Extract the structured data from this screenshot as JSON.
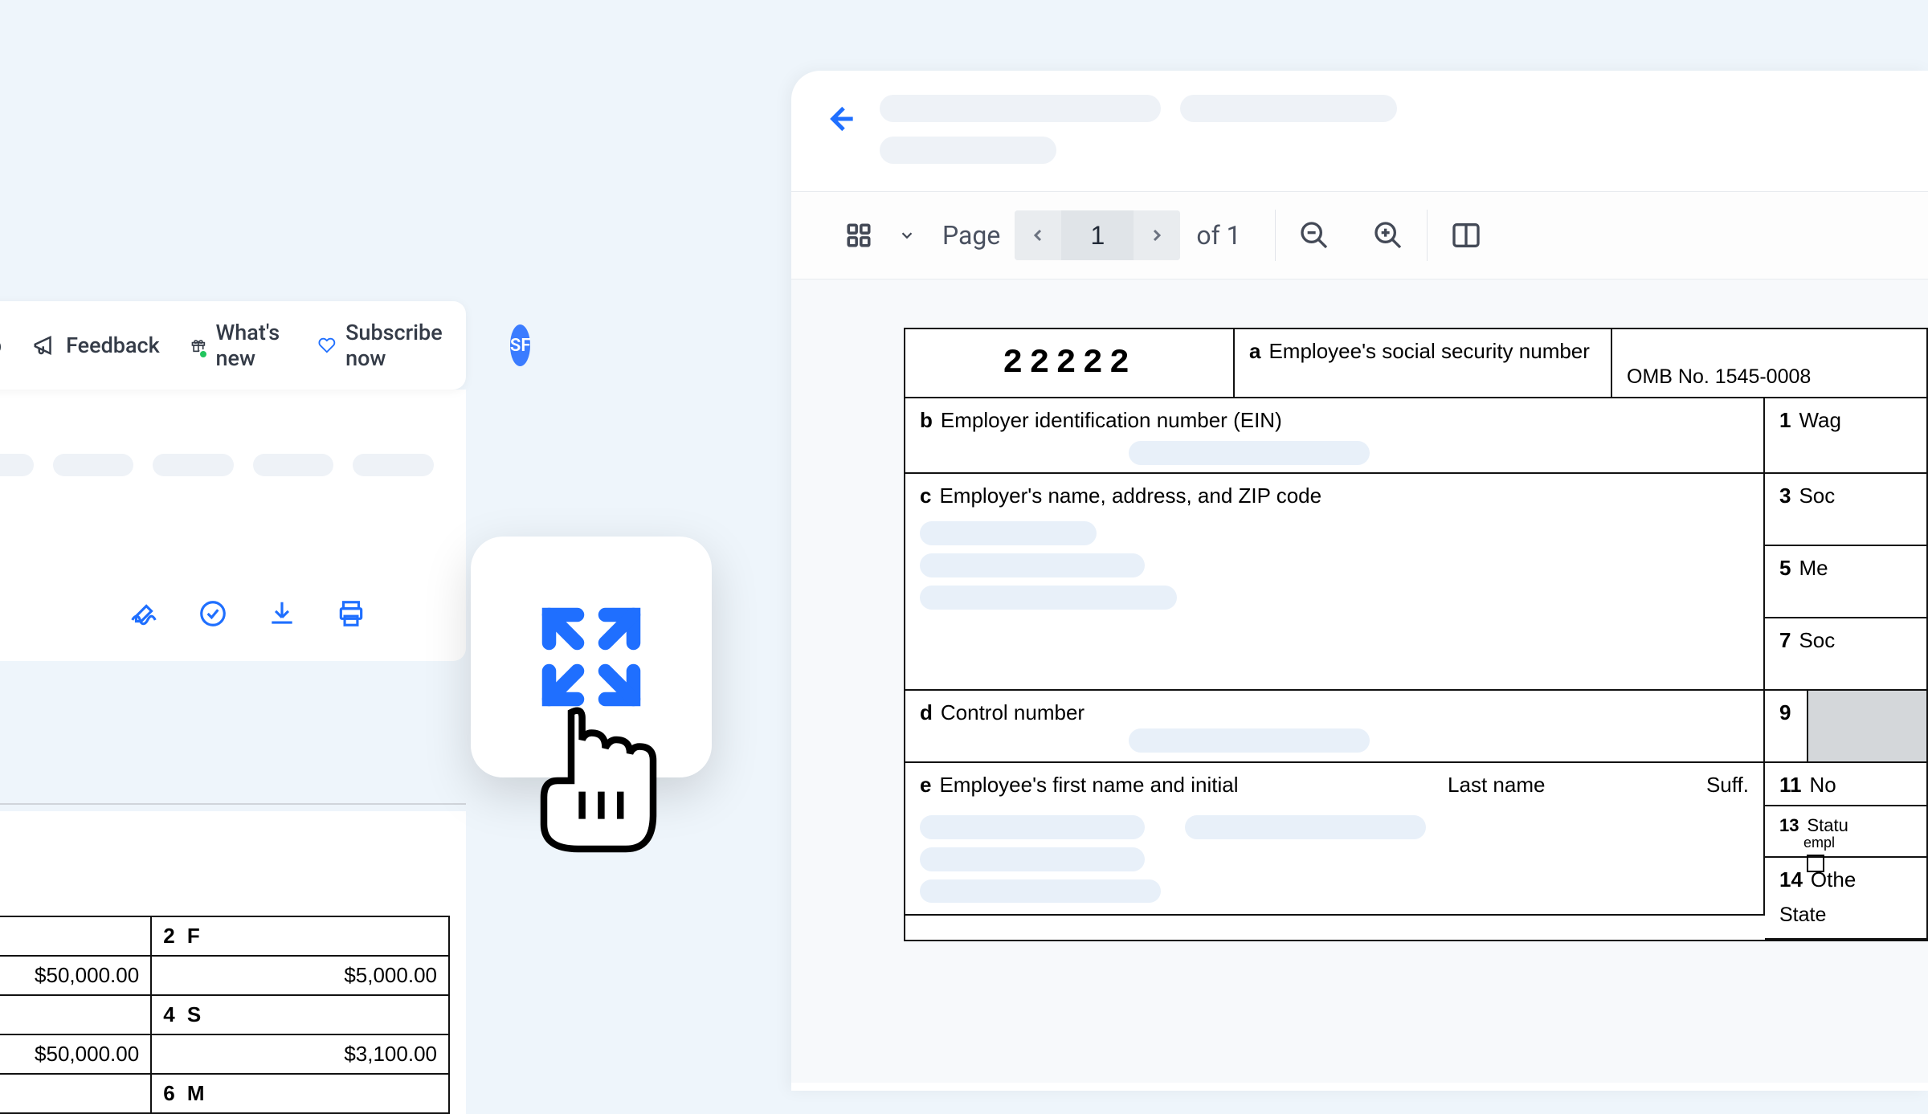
{
  "header": {
    "help_fragment": "lp",
    "feedback": "Feedback",
    "whats_new": "What's new",
    "subscribe": "Subscribe now",
    "avatar_initials": "SF"
  },
  "viewer_toolbar": {
    "page_label": "Page",
    "current_page": "1",
    "total_pages": "of 1"
  },
  "w2": {
    "void_code": "22222",
    "box_a": "Employee's social security number",
    "omb": "OMB No. 1545-0008",
    "box_b": "Employer identification number (EIN)",
    "box_c": "Employer's name, address, and ZIP code",
    "box_d": "Control number",
    "box_e": "Employee's first name and initial",
    "last_name": "Last name",
    "suff": "Suff.",
    "box_1": "Wag",
    "box_3": "Soc",
    "box_5": "Me",
    "box_7": "Soc",
    "box_9": "9",
    "box_11": "No",
    "box_13": "Statu",
    "box_13b": "empl",
    "box_14": "Othe",
    "state": "State"
  },
  "left_form": {
    "box_2": "F",
    "val_1": "$50,000.00",
    "val_2": "$5,000.00",
    "box_4": "S",
    "val_3": "$50,000.00",
    "val_4": "$3,100.00",
    "box_6": "M"
  },
  "colors": {
    "accent": "#1f6fff",
    "bg": "#eef5fb"
  }
}
